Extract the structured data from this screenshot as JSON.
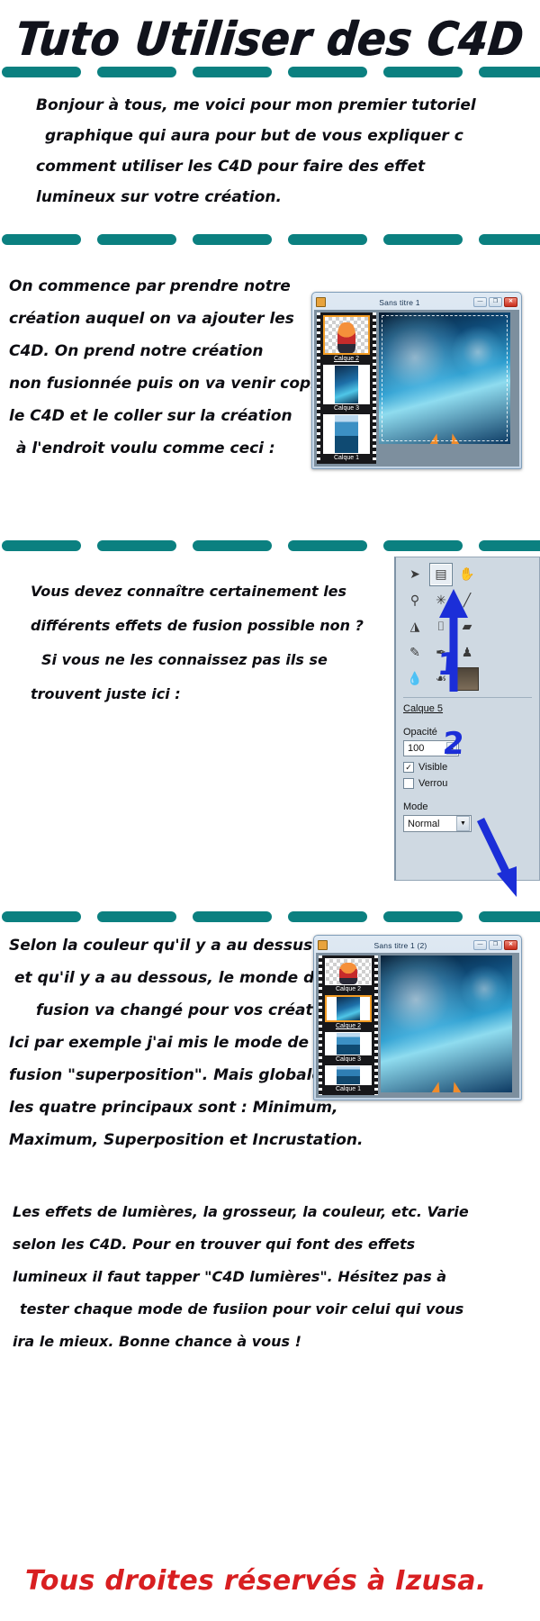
{
  "title": "Tuto Utiliser des C4D",
  "accent_color": "#0b8080",
  "signature_color": "#d81f21",
  "annotation_color": "#1b2ed8",
  "intro": {
    "lines": [
      "Bonjour à tous, me voici pour mon premier tutoriel",
      "graphique qui aura pour but de vous expliquer c",
      "comment utiliser les C4D pour faire des effet",
      "lumineux sur votre création."
    ]
  },
  "step1": {
    "lines": [
      "On commence par prendre notre",
      "création auquel on va ajouter les",
      "C4D. On prend notre création",
      "non fusionnée puis on va venir copier",
      "le C4D et le coller sur la création",
      "à l'endroit voulu comme ceci :"
    ]
  },
  "step2": {
    "lines": [
      "Vous devez connaître certainement les",
      "différents effets de fusion possible non ?",
      "Si vous ne les connaissez pas ils se",
      "trouvent juste ici :"
    ]
  },
  "step3": {
    "lines": [
      "Selon la couleur qu'il y a au dessus",
      "et qu'il y a au dessous, le monde de",
      "fusion va changé pour vos créaton.",
      "Ici par exemple j'ai mis le mode de",
      "fusion \"superposition\". Mais globalement",
      "les quatre principaux sont : Minimum,",
      "Maximum, Superposition et Incrustation."
    ]
  },
  "step4": {
    "lines": [
      "Les effets de lumières, la grosseur, la couleur, etc. Varie",
      "selon les C4D. Pour en trouver qui font des effets",
      "lumineux il faut tapper \"C4D lumières\". Hésitez pas à",
      "tester chaque mode de fusiion pour voir celui qui vous",
      "ira le mieux. Bonne chance à vous !"
    ]
  },
  "signature": "Tous droites réservés à Izusa.",
  "window1": {
    "title": "Sans titre 1",
    "buttons": {
      "minimize": "—",
      "maximize": "❐",
      "close": "✕"
    },
    "layers": [
      {
        "name": "Calque 2",
        "selected": true,
        "art": "character-transparent"
      },
      {
        "name": "Calque 3",
        "selected": false,
        "art": "sky"
      },
      {
        "name": "Calque 1",
        "selected": false,
        "art": "sea"
      }
    ]
  },
  "window2": {
    "title": "Sans titre 1 (2)",
    "buttons": {
      "minimize": "—",
      "maximize": "❐",
      "close": "✕"
    },
    "layers": [
      {
        "name": "Calque 2",
        "selected": false,
        "art": "character-transparent"
      },
      {
        "name": "Calque 2",
        "selected": true,
        "art": "sky"
      },
      {
        "name": "Calque 3",
        "selected": false,
        "art": "sea"
      },
      {
        "name": "Calque 1",
        "selected": false,
        "art": "sea"
      }
    ]
  },
  "tool_panel": {
    "tools": [
      {
        "icon": "➤",
        "name": "pointer-tool",
        "active": false
      },
      {
        "icon": "▤",
        "name": "layers-tool",
        "active": true
      },
      {
        "icon": "✋",
        "name": "hand-tool",
        "active": false
      },
      {
        "icon": "⚲",
        "name": "eyedropper-tool",
        "active": false
      },
      {
        "icon": "✳",
        "name": "magic-wand-tool",
        "active": false
      },
      {
        "icon": "╱",
        "name": "line-tool",
        "active": false
      },
      {
        "icon": "◮",
        "name": "paint-bucket-tool",
        "active": false
      },
      {
        "icon": "⌷",
        "name": "spray-tool",
        "active": false
      },
      {
        "icon": "▰",
        "name": "eraser-tool",
        "active": false
      },
      {
        "icon": "✎",
        "name": "brush-tool",
        "active": false
      },
      {
        "icon": "✒",
        "name": "pen-tool",
        "active": false
      },
      {
        "icon": "♟",
        "name": "clone-stamp-tool",
        "active": false
      },
      {
        "icon": "💧",
        "name": "blur-tool",
        "active": false
      },
      {
        "icon": "☙",
        "name": "smudge-tool",
        "active": false
      },
      {
        "icon": "▦",
        "name": "photo-tool",
        "active": false
      }
    ],
    "layer_name": "Calque 5",
    "opacity_label": "Opacité",
    "opacity_value": "100",
    "visible_label": "Visible",
    "visible_checked": "✓",
    "verrou_label": "Verrou",
    "verrou_checked": "",
    "mode_label": "Mode",
    "mode_value": "Normal",
    "dropdown_arrow": "▼"
  },
  "annotations": {
    "one": "1",
    "two": "2"
  }
}
